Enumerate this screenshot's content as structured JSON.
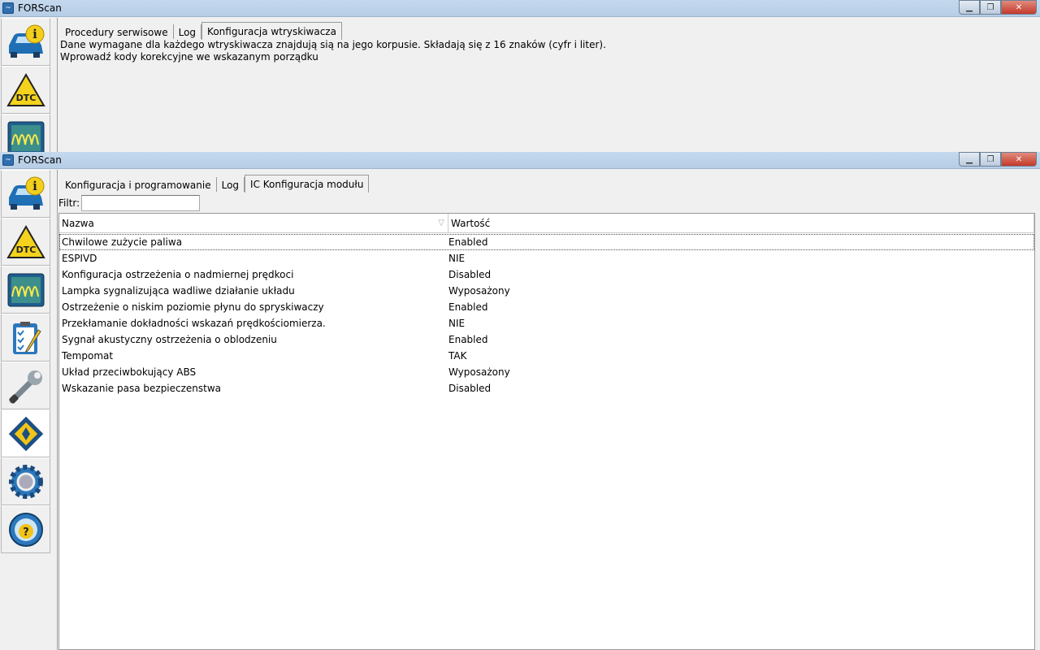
{
  "window1": {
    "title": "FORScan",
    "tabs": [
      "Procedury serwisowe",
      "Log",
      "Konfiguracja wtryskiwacza"
    ],
    "active_tab": 2,
    "message_line1": "Dane wymagane dla każdego wtryskiwacza znajdują sią na jego korpusie. Składają się z 16 znaków (cyfr i liter).",
    "message_line2": "Wprowadź kody korekcyjne we wskazanym porządku"
  },
  "window2": {
    "title": "FORScan",
    "tabs": [
      "Konfiguracja i programowanie",
      "Log",
      "IC Konfiguracja modułu"
    ],
    "active_tab": 2,
    "filter_label": "Filtr:",
    "filter_value": "",
    "columns": [
      "Nazwa",
      "Wartość"
    ],
    "rows": [
      [
        "Chwilowe zużycie paliwa",
        "Enabled"
      ],
      [
        "ESPIVD",
        "NIE"
      ],
      [
        "Konfiguracja ostrzeżenia o nadmiernej prędkoci",
        "Disabled"
      ],
      [
        "Lampka sygnalizująca wadliwe działanie układu",
        "Wyposażony"
      ],
      [
        "Ostrzeżenie o niskim poziomie płynu do spryskiwaczy",
        "Enabled"
      ],
      [
        "Przekłamanie dokładności wskazań prędkościomierza.",
        "NIE"
      ],
      [
        "Sygnał akustyczny ostrzeżenia o oblodzeniu",
        "Enabled"
      ],
      [
        "Tempomat",
        "TAK"
      ],
      [
        "Układ przeciwbokujący ABS",
        "Wyposażony"
      ],
      [
        "Wskazanie pasa bezpieczenstwa",
        "Disabled"
      ]
    ]
  },
  "sidebar_icons": [
    "vehicle-info-icon",
    "dtc-icon",
    "oscilloscope-icon",
    "checklist-icon",
    "wrench-icon",
    "module-config-icon",
    "settings-gear-icon",
    "help-steering-icon"
  ],
  "dtc_label": "DTC"
}
